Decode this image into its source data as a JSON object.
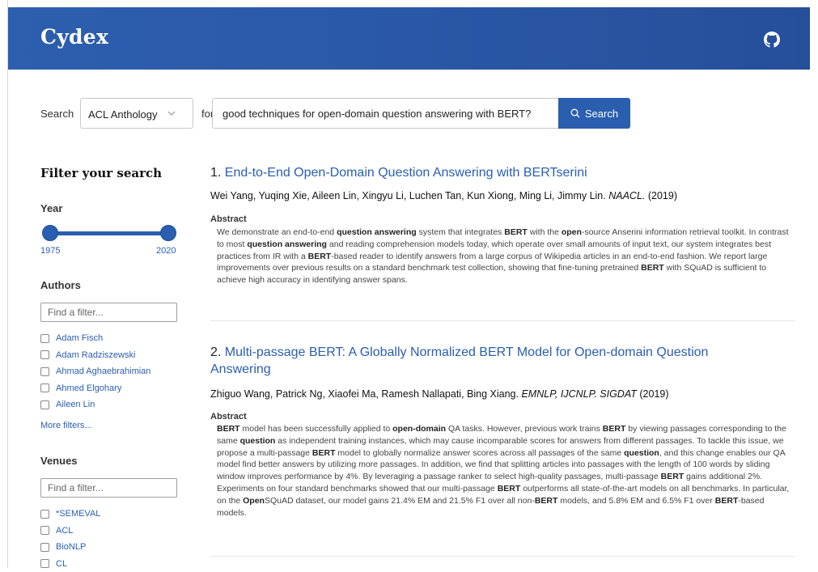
{
  "app": {
    "title": "Cydex",
    "github_icon": "github-icon"
  },
  "search": {
    "label": "Search",
    "collection": "ACL Anthology",
    "for_label": "for",
    "query": "good techniques for open-domain question answering with BERT?",
    "button_label": "Search"
  },
  "sidebar": {
    "title": "Filter your search",
    "year": {
      "label": "Year",
      "min": "1975",
      "max": "2020",
      "selected_range": [
        1975,
        2020
      ]
    },
    "authors": {
      "label": "Authors",
      "placeholder": "Find a filter...",
      "items": [
        "Adam Fisch",
        "Adam Radziszewski",
        "Ahmad Aghaebrahimian",
        "Ahmed Elgohary",
        "Aileen Lin"
      ],
      "more": "More filters..."
    },
    "venues": {
      "label": "Venues",
      "placeholder": "Find a filter...",
      "items": [
        "*SEMEVAL",
        "ACL",
        "BioNLP",
        "CL"
      ]
    }
  },
  "results": [
    {
      "index": "1.",
      "title": "End-to-End Open-Domain Question Answering with BERTserini",
      "authors": "Wei Yang, Yuqing Xie, Aileen Lin, Xingyu Li, Luchen Tan, Kun Xiong, Ming Li, Jimmy Lin.",
      "venue": "NAACL.",
      "year": "(2019)",
      "abstract_label": "Abstract",
      "abstract_html": "We demonstrate an end-to-end <b>question answering</b> system that integrates <b>BERT</b> with the <b>open</b>-source Anserini information retrieval toolkit. In contrast to most <b>question answering</b> and reading comprehension models today, which operate over small amounts of input text, our system integrates best practices from IR with a <b>BERT</b>-based reader to identify answers from a large corpus of Wikipedia articles in an end-to-end fashion. We report large improvements over previous results on a standard benchmark test collection, showing that fine-tuning pretrained <b>BERT</b> with SQuAD is sufficient to achieve high accuracy in identifying answer spans."
    },
    {
      "index": "2.",
      "title": "Multi-passage BERT: A Globally Normalized BERT Model for Open-domain Question Answering",
      "authors": "Zhiguo Wang, Patrick Ng, Xiaofei Ma, Ramesh Nallapati, Bing Xiang.",
      "venue": "EMNLP, IJCNLP. SIGDAT",
      "year": "(2019)",
      "abstract_label": "Abstract",
      "abstract_html": "<b>BERT</b> model has been successfully applied to <b>open-domain</b> QA tasks. However, previous work trains <b>BERT</b> by viewing passages corresponding to the same <b>question</b> as independent training instances, which may cause incomparable scores for answers from different passages. To tackle this issue, we propose a multi-passage <b>BERT</b> model to globally normalize answer scores across all passages of the same <b>question</b>, and this change enables our QA model find better answers by utilizing more passages. In addition, we find that splitting articles into passages with the length of 100 words by sliding window improves performance by 4%. By leveraging a passage ranker to select high-quality passages, multi-passage <b>BERT</b> gains additional 2%. Experiments on four standard benchmarks showed that our multi-passage <b>BERT</b> outperforms all state-of-the-art models on all benchmarks. In particular, on the <b>Open</b>SQuAD dataset, our model gains 21.4% EM and 21.5% F1 over all non-<b>BERT</b> models, and 5.8% EM and 6.5% F1 over <b>BERT</b>-based models."
    }
  ]
}
